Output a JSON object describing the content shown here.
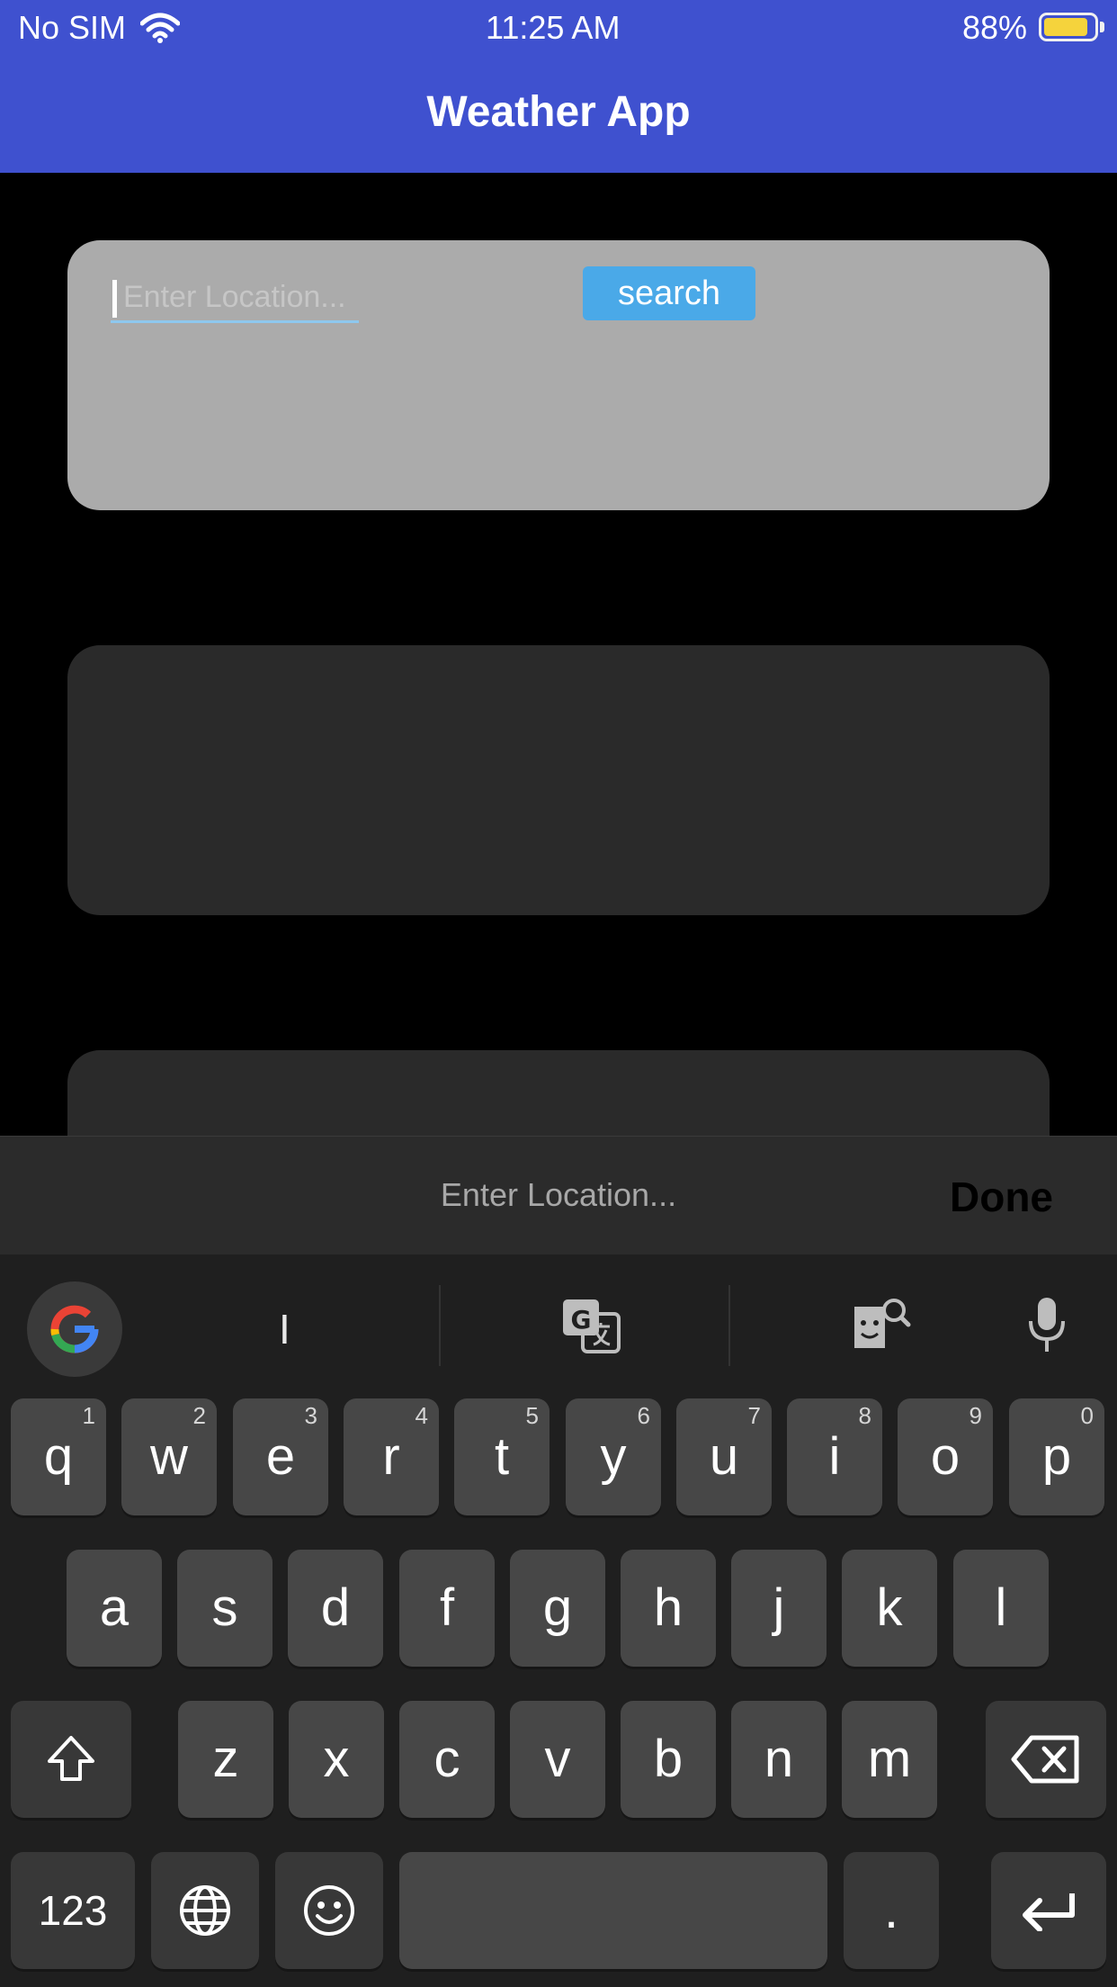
{
  "status_bar": {
    "carrier": "No SIM",
    "time": "11:25 AM",
    "battery": "88%",
    "battery_level": 0.88
  },
  "nav": {
    "title": "Weather App"
  },
  "search": {
    "placeholder": "Enter Location...",
    "button_label": "search"
  },
  "accessory_bar": {
    "placeholder": "Enter Location...",
    "done_label": "Done"
  },
  "keyboard": {
    "suggestion": "I",
    "rows": [
      [
        {
          "l": "q",
          "h": "1"
        },
        {
          "l": "w",
          "h": "2"
        },
        {
          "l": "e",
          "h": "3"
        },
        {
          "l": "r",
          "h": "4"
        },
        {
          "l": "t",
          "h": "5"
        },
        {
          "l": "y",
          "h": "6"
        },
        {
          "l": "u",
          "h": "7"
        },
        {
          "l": "i",
          "h": "8"
        },
        {
          "l": "o",
          "h": "9"
        },
        {
          "l": "p",
          "h": "0"
        }
      ],
      [
        {
          "l": "a"
        },
        {
          "l": "s"
        },
        {
          "l": "d"
        },
        {
          "l": "f"
        },
        {
          "l": "g"
        },
        {
          "l": "h"
        },
        {
          "l": "j"
        },
        {
          "l": "k"
        },
        {
          "l": "l"
        }
      ],
      [
        {
          "l": "z"
        },
        {
          "l": "x"
        },
        {
          "l": "c"
        },
        {
          "l": "v"
        },
        {
          "l": "b"
        },
        {
          "l": "n"
        },
        {
          "l": "m"
        }
      ]
    ],
    "numbers_label": "123",
    "period_label": "."
  },
  "colors": {
    "header": "#3f51cf",
    "search_button": "#4aa9e8",
    "battery_fill": "#f5d33c"
  }
}
